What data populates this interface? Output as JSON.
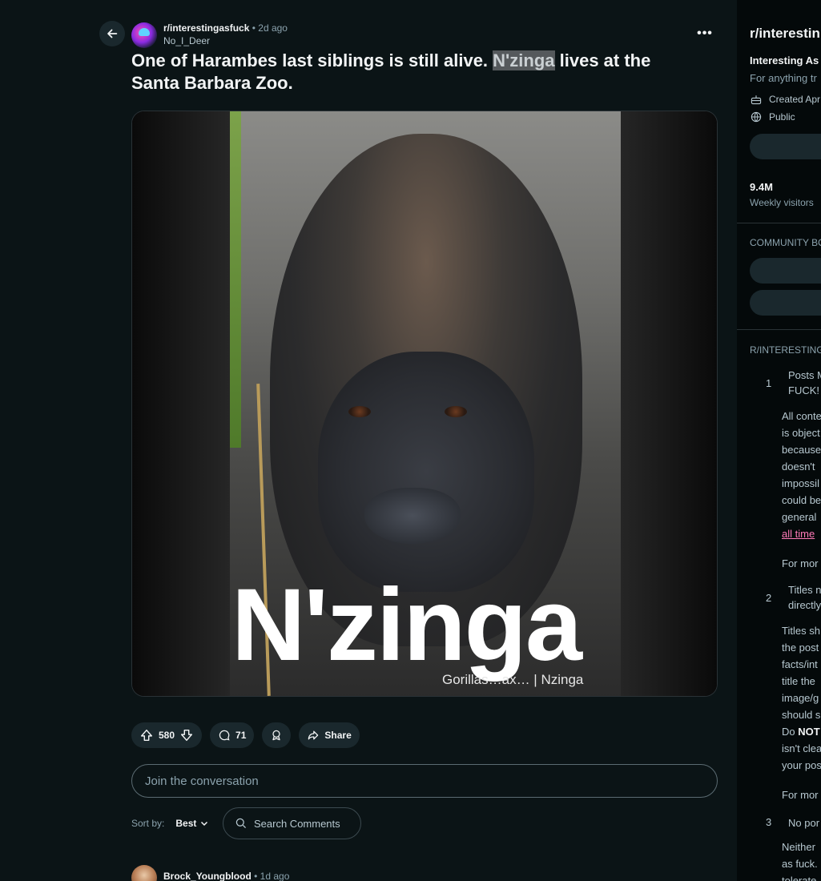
{
  "post": {
    "subreddit": "r/interestingasfuck",
    "separator": "•",
    "age": "2d ago",
    "author": "No_I_Deer",
    "more_label": "•••",
    "title_before": "One of Harambes last siblings is still alive. ",
    "title_highlight": "N'zinga",
    "title_after": " lives at the Santa Barbara Zoo."
  },
  "media": {
    "overlay_text": "N'zinga",
    "credit": "Gorillas…ax…  |  Nzinga"
  },
  "actions": {
    "votes": "580",
    "comments": "71",
    "share": "Share"
  },
  "comments_ui": {
    "join_placeholder": "Join the conversation",
    "sort_label": "Sort by:",
    "sort_value": "Best",
    "search_label": "Search Comments"
  },
  "first_comment": {
    "author": "Brock_Youngblood",
    "separator": "•",
    "age": "1d ago"
  },
  "sidebar": {
    "title": "r/interestin",
    "desc_title": "Interesting As",
    "desc": "For anything tr",
    "created": "Created Apr",
    "visibility": "Public",
    "stat_value": "9.4M",
    "stat_label": "Weekly visitors",
    "bookmarks_header": "COMMUNITY BO",
    "rules_header": "R/INTERESTING",
    "rules": [
      {
        "num": "1",
        "title": [
          "Posts M",
          "FUCK!"
        ],
        "body": [
          "All conte",
          "is object",
          "because",
          "doesn't",
          "impossil",
          "could be",
          "general"
        ],
        "link": "all time",
        "more": "For mor"
      },
      {
        "num": "2",
        "title": [
          "Titles n",
          "directly"
        ],
        "body": [
          "Titles sh",
          "the post",
          "facts/int",
          "title the",
          "image/g",
          "should s"
        ],
        "bold_prefix": "Do ",
        "bold": "NOT",
        "body2": [
          "isn't clea",
          "your pos"
        ],
        "more": "For mor"
      },
      {
        "num": "3",
        "title": [
          "No por"
        ],
        "body": [
          "Neither",
          "as fuck.",
          "tolerate"
        ]
      }
    ]
  }
}
